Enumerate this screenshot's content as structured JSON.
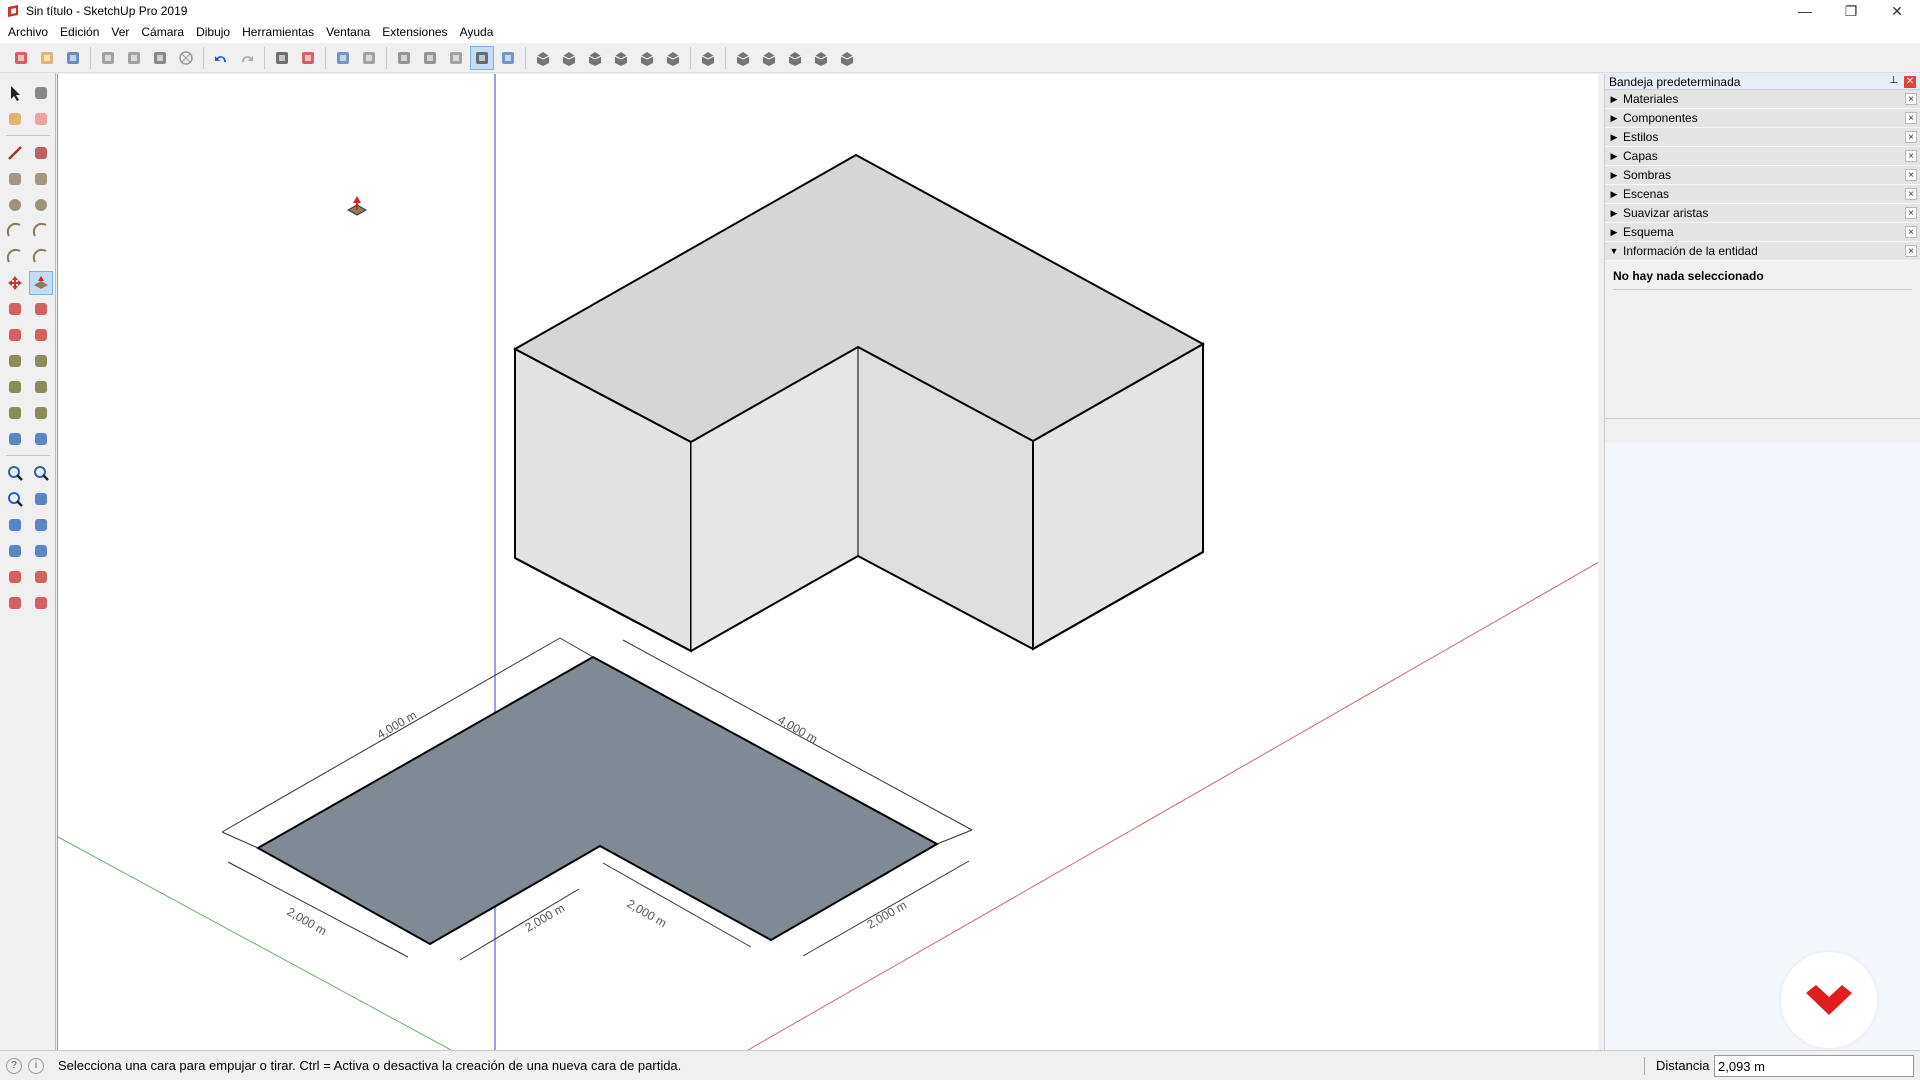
{
  "window": {
    "title": "Sin título - SketchUp Pro 2019",
    "minimize": "—",
    "restore": "❐",
    "close": "✕"
  },
  "menu": [
    "Archivo",
    "Edición",
    "Ver",
    "Cámara",
    "Dibujo",
    "Herramientas",
    "Ventana",
    "Extensiones",
    "Ayuda"
  ],
  "toolbar": {
    "icons": [
      "new-icon",
      "open-icon",
      "save-icon",
      "cut-icon",
      "copy-icon",
      "paste-icon",
      "erase-icon",
      "undo-icon",
      "redo-icon",
      "print-icon",
      "model-info-icon",
      "xray-icon",
      "back-edges-icon",
      "wireframe-icon",
      "hidden-line-icon",
      "shaded-icon",
      "shaded-textures-icon",
      "monochrome-icon",
      "iso-view-icon",
      "top-view-icon",
      "front-view-icon",
      "right-view-icon",
      "back-view-icon",
      "left-view-icon",
      "warehouse-icon",
      "extension-warehouse-icon",
      "layout-icon",
      "send-icon",
      "share-icon",
      "component-icon"
    ],
    "active": "shaded-textures-icon"
  },
  "left_tools": {
    "icons": [
      "select-icon",
      "component-icon",
      "paint-bucket-icon",
      "eraser-icon",
      "line-icon",
      "freehand-icon",
      "rectangle-icon",
      "rotated-rectangle-icon",
      "circle-icon",
      "polygon-icon",
      "arc-icon",
      "two-point-arc-icon",
      "three-point-arc-icon",
      "pie-icon",
      "move-icon",
      "push-pull-icon",
      "rotate-icon",
      "follow-me-icon",
      "scale-icon",
      "offset-icon",
      "tape-measure-icon",
      "dimension-icon",
      "protractor-icon",
      "text-icon",
      "axes-icon",
      "3d-text-icon",
      "orbit-icon",
      "pan-icon",
      "zoom-icon",
      "zoom-window-icon",
      "zoom-extents-icon",
      "previous-view-icon",
      "position-camera-icon",
      "look-around-icon",
      "walk-icon",
      "section-plane-icon",
      "warehouse-icon",
      "share-model-icon",
      "extension-icon",
      "ruby-icon"
    ],
    "active": "push-pull-icon"
  },
  "tray": {
    "title": "Bandeja predeterminada",
    "pin": "📌",
    "close": "✕",
    "panels": [
      {
        "label": "Materiales",
        "expanded": false
      },
      {
        "label": "Componentes",
        "expanded": false
      },
      {
        "label": "Estilos",
        "expanded": false
      },
      {
        "label": "Capas",
        "expanded": false
      },
      {
        "label": "Sombras",
        "expanded": false
      },
      {
        "label": "Escenas",
        "expanded": false
      },
      {
        "label": "Suavizar aristas",
        "expanded": false
      },
      {
        "label": "Esquema",
        "expanded": false
      },
      {
        "label": "Información de la entidad",
        "expanded": true
      }
    ],
    "entity_info": "No hay nada seleccionado"
  },
  "dimensions": {
    "back_left": "4,000 m",
    "back_right": "4,000 m",
    "front_left": "2,000 m",
    "inner_left": "2,000 m",
    "inner_right": "2,000 m",
    "front_right": "2,000 m"
  },
  "status": {
    "message": "Selecciona una cara para empujar o tirar. Ctrl = Activa o desactiva la creación de una nueva cara de partida.",
    "measure_label": "Distancia",
    "measure_value": "2,093 m"
  },
  "colors": {
    "face_fill": "#808a94",
    "box_top": "#d5d5d5",
    "box_side": "#e4e4e4",
    "axis_blue": "#3b3bd1",
    "axis_red": "#c07070",
    "axis_green": "#6fae6f",
    "logo_red": "#e01e1e"
  }
}
